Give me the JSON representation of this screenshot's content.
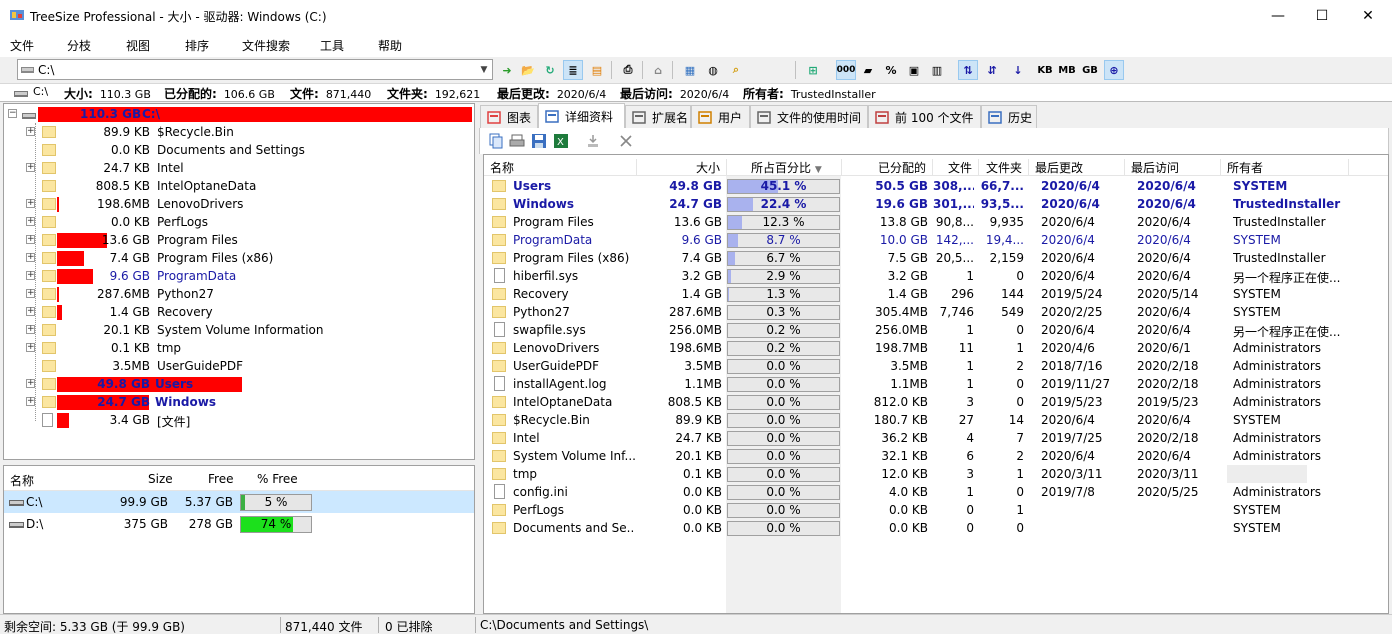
{
  "window": {
    "title": "TreeSize Professional - 大小 - 驱动器: Windows (C:)",
    "minimize": "—",
    "maximize": "☐",
    "close": "✕"
  },
  "menu": [
    "文件",
    "分枝",
    "视图",
    "排序",
    "文件搜索",
    "工具",
    "帮助"
  ],
  "toolbar": {
    "path": "C:\\",
    "units": [
      "KB",
      "MB",
      "GB"
    ],
    "percent_symbol": "%"
  },
  "infobar": {
    "drive": "C:\\",
    "size_label": "大小:",
    "size_value": "110.3 GB",
    "allocated_label": "已分配的:",
    "allocated_value": "106.6 GB",
    "files_label": "文件:",
    "files_value": "871,440",
    "folders_label": "文件夹:",
    "folders_value": "192,621",
    "modified_label": "最后更改:",
    "modified_value": "2020/6/4",
    "accessed_label": "最后访问:",
    "accessed_value": "2020/6/4",
    "owner_label": "所有者:",
    "owner_value": "TrustedInstaller"
  },
  "tree": {
    "root": {
      "size": "110.3 GB",
      "name": "C:\\",
      "bar": 1.0
    },
    "items": [
      {
        "size": "89.9 KB",
        "name": "$Recycle.Bin",
        "bar": 0.0,
        "style": "normal",
        "expandable": true,
        "type": "folder"
      },
      {
        "size": "0.0 KB",
        "name": "Documents and Settings",
        "bar": 0.0,
        "style": "normal",
        "expandable": false,
        "type": "link"
      },
      {
        "size": "24.7 KB",
        "name": "Intel",
        "bar": 0.0,
        "style": "normal",
        "expandable": true,
        "type": "folder"
      },
      {
        "size": "808.5 KB",
        "name": "IntelOptaneData",
        "bar": 0.0,
        "style": "normal",
        "expandable": false,
        "type": "folder"
      },
      {
        "size": "198.6MB",
        "name": "LenovoDrivers",
        "bar": 0.002,
        "style": "normal",
        "expandable": true,
        "type": "folder"
      },
      {
        "size": "0.0 KB",
        "name": "PerfLogs",
        "bar": 0.0,
        "style": "normal",
        "expandable": true,
        "type": "folder"
      },
      {
        "size": "13.6 GB",
        "name": "Program Files",
        "bar": 0.123,
        "style": "normal",
        "expandable": true,
        "type": "folder"
      },
      {
        "size": "7.4 GB",
        "name": "Program Files (x86)",
        "bar": 0.067,
        "style": "normal",
        "expandable": true,
        "type": "folder"
      },
      {
        "size": "9.6 GB",
        "name": "ProgramData",
        "bar": 0.087,
        "style": "blue",
        "expandable": true,
        "type": "folder"
      },
      {
        "size": "287.6MB",
        "name": "Python27",
        "bar": 0.003,
        "style": "normal",
        "expandable": true,
        "type": "folder"
      },
      {
        "size": "1.4 GB",
        "name": "Recovery",
        "bar": 0.013,
        "style": "normal",
        "expandable": true,
        "type": "folder"
      },
      {
        "size": "20.1 KB",
        "name": "System Volume Information",
        "bar": 0.0,
        "style": "normal",
        "expandable": true,
        "type": "folder"
      },
      {
        "size": "0.1 KB",
        "name": "tmp",
        "bar": 0.0,
        "style": "normal",
        "expandable": true,
        "type": "folder"
      },
      {
        "size": "3.5MB",
        "name": "UserGuidePDF",
        "bar": 0.0,
        "style": "normal",
        "expandable": false,
        "type": "folder"
      },
      {
        "size": "49.8 GB",
        "name": "Users",
        "bar": 0.451,
        "style": "bold-blue",
        "expandable": true,
        "type": "folder"
      },
      {
        "size": "24.7 GB",
        "name": "Windows",
        "bar": 0.224,
        "style": "bold-blue",
        "expandable": true,
        "type": "folder"
      },
      {
        "size": "3.4 GB",
        "name": "[文件]",
        "bar": 0.029,
        "style": "normal",
        "expandable": false,
        "type": "file"
      }
    ]
  },
  "drives": {
    "headers": [
      "名称",
      "Size",
      "Free",
      "% Free"
    ],
    "rows": [
      {
        "name": "C:\\",
        "size": "99.9 GB",
        "free": "5.37 GB",
        "pct": "5 %",
        "pct_value": 0.05,
        "color": "#3cb043",
        "selected": true
      },
      {
        "name": "D:\\",
        "size": "375 GB",
        "free": "278 GB",
        "pct": "74 %",
        "pct_value": 0.74,
        "color": "#1ce01c",
        "selected": false
      }
    ]
  },
  "tabs": [
    {
      "label": "图表",
      "active": false
    },
    {
      "label": "详细资料",
      "active": true
    },
    {
      "label": "扩展名",
      "active": false
    },
    {
      "label": "用户",
      "active": false
    },
    {
      "label": "文件的使用时间",
      "active": false
    },
    {
      "label": "前 100 个文件",
      "active": false
    },
    {
      "label": "历史",
      "active": false
    }
  ],
  "details": {
    "headers": {
      "name": "名称",
      "size": "大小",
      "pct": "所占百分比",
      "alloc": "已分配的",
      "files": "文件",
      "folders": "文件夹",
      "modified": "最后更改",
      "accessed": "最后访问",
      "owner": "所有者"
    },
    "rows": [
      {
        "type": "folder",
        "name": "Users",
        "size": "49.8 GB",
        "pct": "45.1 %",
        "pct_value": 0.451,
        "alloc": "50.5 GB",
        "files": "308,...",
        "folders": "66,7...",
        "modified": "2020/6/4",
        "accessed": "2020/6/4",
        "owner": "SYSTEM",
        "style": "bold-blue"
      },
      {
        "type": "folder",
        "name": "Windows",
        "size": "24.7 GB",
        "pct": "22.4 %",
        "pct_value": 0.224,
        "alloc": "19.6 GB",
        "files": "301,...",
        "folders": "93,5...",
        "modified": "2020/6/4",
        "accessed": "2020/6/4",
        "owner": "TrustedInstaller",
        "style": "bold-blue"
      },
      {
        "type": "folder",
        "name": "Program Files",
        "size": "13.6 GB",
        "pct": "12.3 %",
        "pct_value": 0.123,
        "alloc": "13.8 GB",
        "files": "90,8...",
        "folders": "9,935",
        "modified": "2020/6/4",
        "accessed": "2020/6/4",
        "owner": "TrustedInstaller",
        "style": "normal"
      },
      {
        "type": "folder",
        "name": "ProgramData",
        "size": "9.6 GB",
        "pct": "8.7 %",
        "pct_value": 0.087,
        "alloc": "10.0 GB",
        "files": "142,...",
        "folders": "19,4...",
        "modified": "2020/6/4",
        "accessed": "2020/6/4",
        "owner": "SYSTEM",
        "style": "blue"
      },
      {
        "type": "folder",
        "name": "Program Files (x86)",
        "size": "7.4 GB",
        "pct": "6.7 %",
        "pct_value": 0.067,
        "alloc": "7.5 GB",
        "files": "20,5...",
        "folders": "2,159",
        "modified": "2020/6/4",
        "accessed": "2020/6/4",
        "owner": "TrustedInstaller",
        "style": "normal"
      },
      {
        "type": "file",
        "name": "hiberfil.sys",
        "size": "3.2 GB",
        "pct": "2.9 %",
        "pct_value": 0.029,
        "alloc": "3.2 GB",
        "files": "1",
        "folders": "0",
        "modified": "2020/6/4",
        "accessed": "2020/6/4",
        "owner": "另一个程序正在使...",
        "style": "normal"
      },
      {
        "type": "folder",
        "name": "Recovery",
        "size": "1.4 GB",
        "pct": "1.3 %",
        "pct_value": 0.013,
        "alloc": "1.4 GB",
        "files": "296",
        "folders": "144",
        "modified": "2019/5/24",
        "accessed": "2020/5/14",
        "owner": "SYSTEM",
        "style": "normal"
      },
      {
        "type": "folder",
        "name": "Python27",
        "size": "287.6MB",
        "pct": "0.3 %",
        "pct_value": 0.003,
        "alloc": "305.4MB",
        "files": "7,746",
        "folders": "549",
        "modified": "2020/2/25",
        "accessed": "2020/6/4",
        "owner": "SYSTEM",
        "style": "normal"
      },
      {
        "type": "file",
        "name": "swapfile.sys",
        "size": "256.0MB",
        "pct": "0.2 %",
        "pct_value": 0.002,
        "alloc": "256.0MB",
        "files": "1",
        "folders": "0",
        "modified": "2020/6/4",
        "accessed": "2020/6/4",
        "owner": "另一个程序正在使...",
        "style": "normal"
      },
      {
        "type": "folder",
        "name": "LenovoDrivers",
        "size": "198.6MB",
        "pct": "0.2 %",
        "pct_value": 0.002,
        "alloc": "198.7MB",
        "files": "11",
        "folders": "1",
        "modified": "2020/4/6",
        "accessed": "2020/6/1",
        "owner": "Administrators",
        "style": "normal"
      },
      {
        "type": "folder",
        "name": "UserGuidePDF",
        "size": "3.5MB",
        "pct": "0.0 %",
        "pct_value": 0.0,
        "alloc": "3.5MB",
        "files": "1",
        "folders": "2",
        "modified": "2018/7/16",
        "accessed": "2020/2/18",
        "owner": "Administrators",
        "style": "normal"
      },
      {
        "type": "file",
        "name": "installAgent.log",
        "size": "1.1MB",
        "pct": "0.0 %",
        "pct_value": 0.0,
        "alloc": "1.1MB",
        "files": "1",
        "folders": "0",
        "modified": "2019/11/27",
        "accessed": "2020/2/18",
        "owner": "Administrators",
        "style": "normal"
      },
      {
        "type": "folder",
        "name": "IntelOptaneData",
        "size": "808.5 KB",
        "pct": "0.0 %",
        "pct_value": 0.0,
        "alloc": "812.0 KB",
        "files": "3",
        "folders": "0",
        "modified": "2019/5/23",
        "accessed": "2019/5/23",
        "owner": "Administrators",
        "style": "normal"
      },
      {
        "type": "folder",
        "name": "$Recycle.Bin",
        "size": "89.9 KB",
        "pct": "0.0 %",
        "pct_value": 0.0,
        "alloc": "180.7 KB",
        "files": "27",
        "folders": "14",
        "modified": "2020/6/4",
        "accessed": "2020/6/4",
        "owner": "SYSTEM",
        "style": "normal"
      },
      {
        "type": "folder",
        "name": "Intel",
        "size": "24.7 KB",
        "pct": "0.0 %",
        "pct_value": 0.0,
        "alloc": "36.2 KB",
        "files": "4",
        "folders": "7",
        "modified": "2019/7/25",
        "accessed": "2020/2/18",
        "owner": "Administrators",
        "style": "normal"
      },
      {
        "type": "folder",
        "name": "System Volume Inf...",
        "size": "20.1 KB",
        "pct": "0.0 %",
        "pct_value": 0.0,
        "alloc": "32.1 KB",
        "files": "6",
        "folders": "2",
        "modified": "2020/6/4",
        "accessed": "2020/6/4",
        "owner": "Administrators",
        "style": "normal"
      },
      {
        "type": "folder",
        "name": "tmp",
        "size": "0.1 KB",
        "pct": "0.0 %",
        "pct_value": 0.0,
        "alloc": "12.0 KB",
        "files": "3",
        "folders": "1",
        "modified": "2020/3/11",
        "accessed": "2020/3/11",
        "owner": "",
        "style": "normal",
        "blur": true
      },
      {
        "type": "file",
        "name": "config.ini",
        "size": "0.0 KB",
        "pct": "0.0 %",
        "pct_value": 0.0,
        "alloc": "4.0 KB",
        "files": "1",
        "folders": "0",
        "modified": "2019/7/8",
        "accessed": "2020/5/25",
        "owner": "Administrators",
        "style": "normal"
      },
      {
        "type": "folder",
        "name": "PerfLogs",
        "size": "0.0 KB",
        "pct": "0.0 %",
        "pct_value": 0.0,
        "alloc": "0.0 KB",
        "files": "0",
        "folders": "1",
        "modified": "",
        "accessed": "",
        "owner": "SYSTEM",
        "style": "normal"
      },
      {
        "type": "folder",
        "name": "Documents and Se...",
        "size": "0.0 KB",
        "pct": "0.0 %",
        "pct_value": 0.0,
        "alloc": "0.0 KB",
        "files": "0",
        "folders": "0",
        "modified": "",
        "accessed": "",
        "owner": "SYSTEM",
        "style": "normal"
      }
    ]
  },
  "status": {
    "free_space": "剩余空间: 5.33 GB  (于 99.9 GB)",
    "files": "871,440  文件",
    "excluded": "0 已排除",
    "path": "C:\\Documents and Settings\\"
  },
  "colors": {
    "tree_bar": "#ff0000",
    "pct_bar": "#a9b2ee",
    "selected_row": "#cce8ff",
    "blue_text": "#1a1aa6"
  }
}
